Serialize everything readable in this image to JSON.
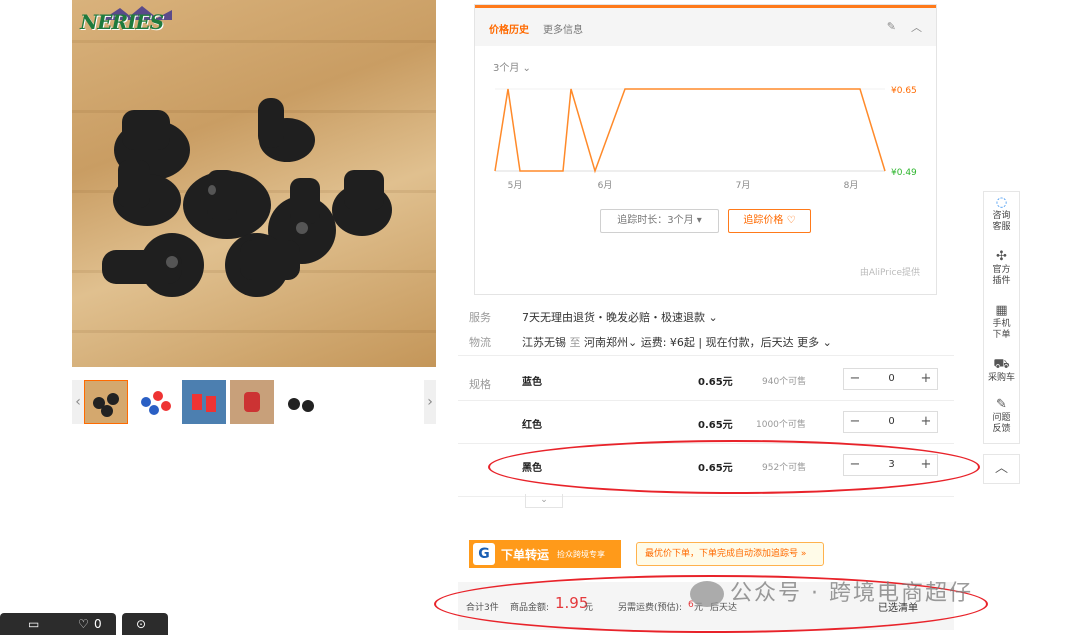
{
  "brand_logo": "NERIES",
  "price_history": {
    "tab_active": "价格历史",
    "tab_other": "更多信息",
    "range": "3个月",
    "y_max_label": "¥0.65",
    "y_min_label": "¥0.49",
    "x_labels": [
      "5月",
      "6月",
      "7月",
      "8月"
    ],
    "series": [
      0.49,
      0.65,
      0.49,
      0.49,
      0.65,
      0.49,
      0.65,
      0.65,
      0.65,
      0.65,
      0.65,
      0.65,
      0.65,
      0.49
    ],
    "track_duration_label": "追踪时长：3个月",
    "track_price_label": "追踪价格 ♡",
    "provider": "由AliPrice提供",
    "line_color": "#ff8a2a"
  },
  "attributes": {
    "service_label": "服务",
    "service_value": "7天无理由退货・晚发必赔・极速退款",
    "logistics_label": "物流",
    "logistics_from": "江苏无锡",
    "logistics_to_word": "至",
    "logistics_to": "河南郑州",
    "logistics_fee": "运费: ¥6起",
    "logistics_payment": "现在付款，后天达",
    "logistics_more": "更多",
    "spec_label": "规格"
  },
  "skus": [
    {
      "name": "蓝色",
      "price": "0.65元",
      "stock": "940个可售",
      "qty": "0"
    },
    {
      "name": "红色",
      "price": "0.65元",
      "stock": "1000个可售",
      "qty": "0"
    },
    {
      "name": "黑色",
      "price": "0.65元",
      "stock": "952个可售",
      "qty": "3"
    }
  ],
  "transfer": {
    "title": "下单转运",
    "subtitle": "捡众跨境专享",
    "tip": "最优价下单，下单完成自动添加追踪号 »"
  },
  "totals": {
    "count": "合计3件",
    "amount_label": "商品金额:",
    "amount": "1.95",
    "amount_unit": "元",
    "shipping_label": "另需运费(预估):",
    "shipping_value": "6",
    "shipping_unit": "元",
    "arrival": "后天达",
    "selected_list": "已选清单"
  },
  "watermark": "公众号 · 跨境电商超仔",
  "toolbar": {
    "consult": "咨询客服",
    "plugin": "官方插件",
    "mobile": "手机下单",
    "cart": "采购车",
    "feedback": "问题反馈"
  },
  "dock": {
    "likes": "0"
  }
}
